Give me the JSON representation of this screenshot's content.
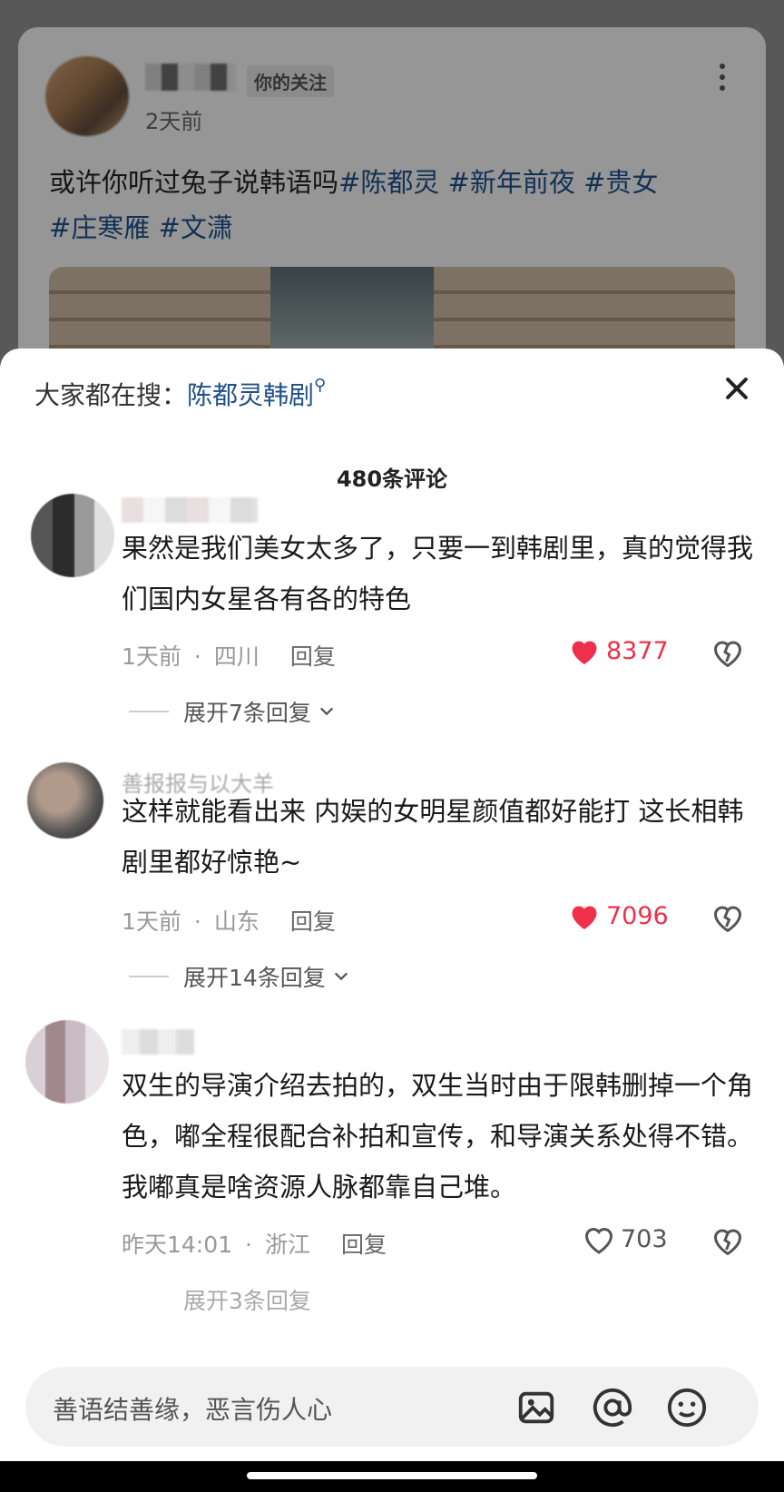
{
  "post": {
    "follow_badge": "你的关注",
    "time": "2天前",
    "text": "或许你听过兔子说韩语吗",
    "tags": [
      "#陈都灵",
      "#新年前夜",
      "#贵女",
      "#庄寒雁",
      "#文潇"
    ]
  },
  "sheet": {
    "search_prefix": "大家都在搜：",
    "search_keyword": "陈都灵韩剧",
    "comment_count": "480条评论"
  },
  "comments": [
    {
      "text": "果然是我们美女太多了，只要一到韩剧里，真的觉得我们国内女星各有各的特色",
      "time": "1天前",
      "location": "四川",
      "reply": "回复",
      "likes": "8377",
      "expand": "展开7条回复"
    },
    {
      "name": "善报报与以大羊",
      "text": "这样就能看出来 内娱的女明星颜值都好能打  这长相韩剧里都好惊艳~",
      "time": "1天前",
      "location": "山东",
      "reply": "回复",
      "likes": "7096",
      "expand": "展开14条回复"
    },
    {
      "text": "双生的导演介绍去拍的，双生当时由于限韩删掉一个角色，嘟全程很配合补拍和宣传，和导演关系处得不错。我嘟真是啥资源人脉都靠自己堆。",
      "time": "昨天14:01",
      "location": "浙江",
      "reply": "回复",
      "likes": "703",
      "expand": "展开3条回复"
    }
  ],
  "input": {
    "placeholder": "善语结善缘，恶言伤人心"
  },
  "colors": {
    "link_blue": "#1f4f89",
    "like_red": "#f0304a"
  }
}
